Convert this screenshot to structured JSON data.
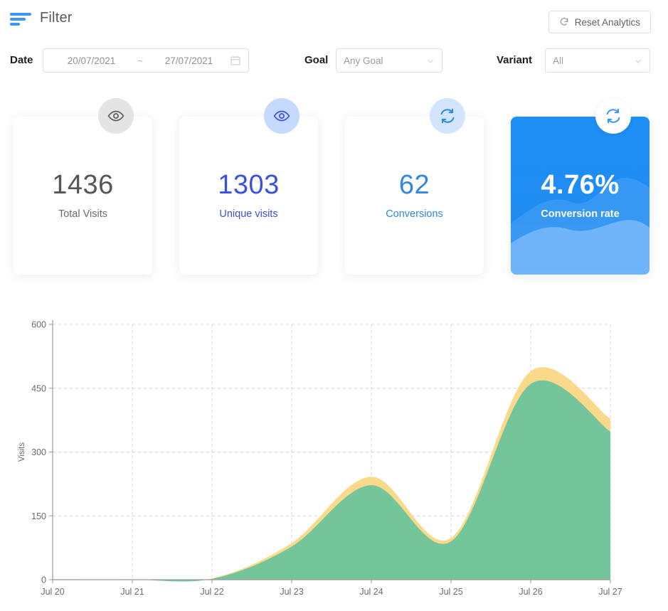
{
  "header": {
    "filter_icon": "filter-icon",
    "title": "Filter",
    "reset_button": {
      "icon": "refresh-icon",
      "label": "Reset Analytics"
    }
  },
  "filters": {
    "date": {
      "label": "Date",
      "start": "20/07/2021",
      "separator": "~",
      "end": "27/07/2021",
      "icon": "calendar-icon"
    },
    "goal": {
      "label": "Goal",
      "value": "Any Goal",
      "icon": "chevron-down-icon"
    },
    "variant": {
      "label": "Variant",
      "value": "All",
      "icon": "chevron-down-icon"
    }
  },
  "stats": [
    {
      "value": "1436",
      "label": "Total Visits",
      "icon": "eye-icon",
      "accent": "#565656",
      "badge_bg": "#e4e4e4",
      "highlight": false
    },
    {
      "value": "1303",
      "label": "Unique visits",
      "icon": "eye-icon",
      "accent": "#3b4fe0",
      "badge_bg": "#c6daff",
      "highlight": false
    },
    {
      "value": "62",
      "label": "Conversions",
      "icon": "refresh-icon",
      "accent": "#2f87e0",
      "badge_bg": "#d3e4fd",
      "highlight": false
    },
    {
      "value": "4.76%",
      "label": "Conversion rate",
      "icon": "refresh-icon",
      "accent": "#ffffff",
      "badge_bg": "#ffffff",
      "highlight": true
    }
  ],
  "colors": {
    "accent_blue": "#3b97f3",
    "card_blue_top": "#1e8ff5",
    "card_blue_bottom": "#2a8bef",
    "wave_light": "#6eb3f7",
    "series_unique": "#74c69a",
    "series_total": "#fad98b"
  },
  "chart_data": {
    "type": "area",
    "title": "",
    "xlabel": "",
    "ylabel": "Visits",
    "grid": true,
    "legend": "none",
    "ylim": [
      0,
      600
    ],
    "yticks": [
      0,
      150,
      300,
      450,
      600
    ],
    "x": [
      "Jul 20",
      "Jul 21",
      "Jul 22",
      "Jul 23",
      "Jul 24",
      "Jul 25",
      "Jul 26",
      "Jul 27"
    ],
    "xticklabels": [
      "Jul 20",
      "Jul 21",
      "Jul 22",
      "Jul 23",
      "Jul 24",
      "Jul 25",
      "Jul 26",
      "Jul 27"
    ],
    "series": [
      {
        "name": "Total Visits",
        "color": "#fad98b",
        "values": [
          1,
          1,
          3,
          86,
          242,
          98,
          490,
          378
        ]
      },
      {
        "name": "Unique visits",
        "color": "#74c69a",
        "values": [
          0,
          0,
          2,
          78,
          222,
          90,
          460,
          348
        ]
      }
    ]
  }
}
